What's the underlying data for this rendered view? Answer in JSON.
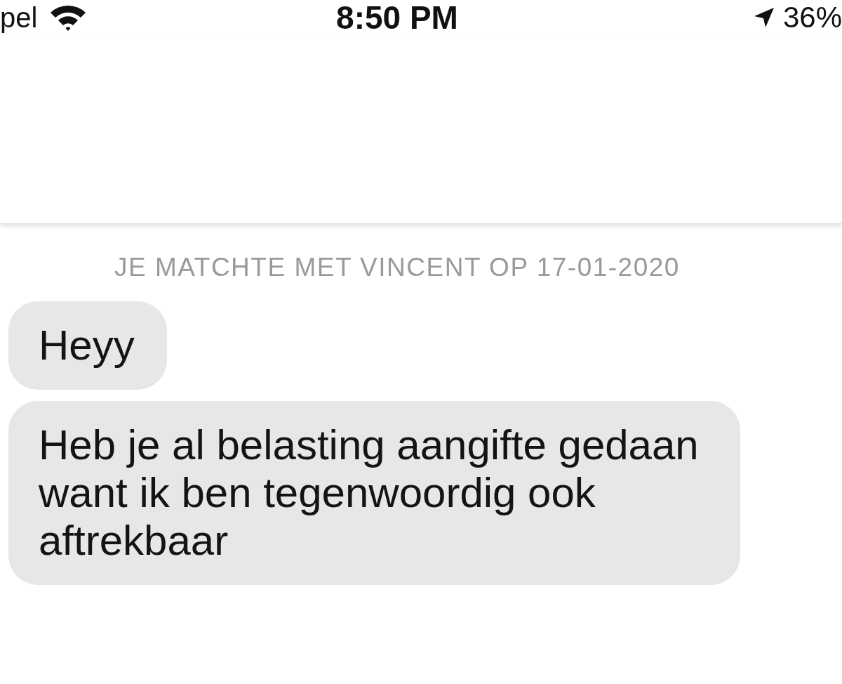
{
  "status_bar": {
    "carrier": "pel",
    "time": "8:50 PM",
    "battery": "36%"
  },
  "match_notice": "JE MATCHTE MET VINCENT OP 17-01-2020",
  "messages": [
    {
      "text": "Heyy"
    },
    {
      "text": "Heb je al belasting aangifte gedaan want ik ben tegenwoordig ook aftrekbaar"
    }
  ]
}
